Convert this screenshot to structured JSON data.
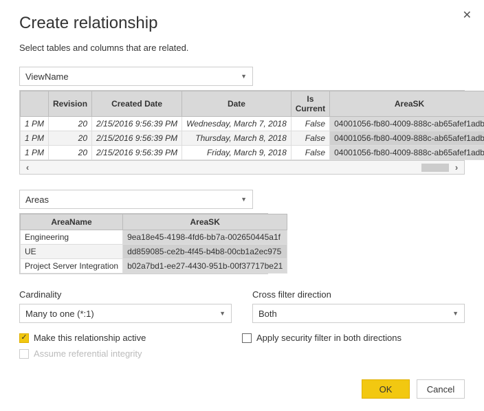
{
  "title": "Create relationship",
  "subtitle": "Select tables and columns that are related.",
  "table1": {
    "dropdown": "ViewName",
    "headers": {
      "h0": "",
      "h1": "Revision",
      "h2": "Created Date",
      "h3": "Date",
      "h4": "Is Current",
      "h5": "AreaSK"
    },
    "rows": [
      {
        "c0": "1 PM",
        "c1": "20",
        "c2": "2/15/2016 9:56:39 PM",
        "c3": "Wednesday, March 7, 2018",
        "c4": "False",
        "c5": "04001056-fb80-4009-888c-ab65afef1adb"
      },
      {
        "c0": "1 PM",
        "c1": "20",
        "c2": "2/15/2016 9:56:39 PM",
        "c3": "Thursday, March 8, 2018",
        "c4": "False",
        "c5": "04001056-fb80-4009-888c-ab65afef1adb"
      },
      {
        "c0": "1 PM",
        "c1": "20",
        "c2": "2/15/2016 9:56:39 PM",
        "c3": "Friday, March 9, 2018",
        "c4": "False",
        "c5": "04001056-fb80-4009-888c-ab65afef1adb"
      }
    ]
  },
  "table2": {
    "dropdown": "Areas",
    "headers": {
      "h0": "AreaName",
      "h1": "AreaSK"
    },
    "rows": [
      {
        "c0": "Engineering",
        "c1": "9ea18e45-4198-4fd6-bb7a-002650445a1f"
      },
      {
        "c0": "UE",
        "c1": "dd859085-ce2b-4f45-b4b8-00cb1a2ec975"
      },
      {
        "c0": "Project Server Integration",
        "c1": "b02a7bd1-ee27-4430-951b-00f37717be21"
      }
    ]
  },
  "cardinality": {
    "label": "Cardinality",
    "value": "Many to one (*:1)"
  },
  "crossfilter": {
    "label": "Cross filter direction",
    "value": "Both"
  },
  "checks": {
    "active": "Make this relationship active",
    "integrity": "Assume referential integrity",
    "security": "Apply security filter in both directions"
  },
  "buttons": {
    "ok": "OK",
    "cancel": "Cancel"
  }
}
